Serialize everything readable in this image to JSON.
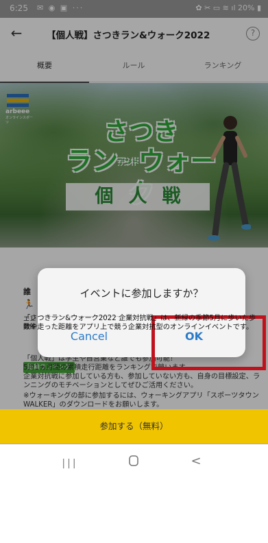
{
  "status_bar": {
    "time": "6:25",
    "left_icons": "✉ ◉ ▣ ···",
    "battery": "20%",
    "right_icons": "✿ ✂ ▭ ≋ ıl 20% ▮"
  },
  "header": {
    "back_icon": "←",
    "title": "【個人戦】さつきラン&ウォーク2022",
    "help_icon": "?"
  },
  "tabs": [
    {
      "label": "概要",
      "active": true
    },
    {
      "label": "ルール",
      "active": false
    },
    {
      "label": "ランキング",
      "active": false
    }
  ],
  "hero": {
    "logo_brand": "arbeee",
    "logo_sub": "オンラインスポーツ",
    "title_line1": "さつき",
    "title_line2a": "ラン",
    "title_and": "アンド",
    "title_line2b": "ウォーク",
    "subtitle": "個人戦"
  },
  "content": {
    "category_prefix": "誰",
    "runner_icon": "🏃",
    "small_text": "エン\n開催",
    "ranking_badge": "距離ランキング",
    "paragraph1": "「さつきラン&ウォーク2022 企業対抗戦」は、新緑の季節5月に歩いた歩数や走った距離をアプリ上で競う企業対抗型のオンラインイベントです。",
    "paragraph2": "「個人戦」は学生や自営業など誰でも参加可能！\n5月1ヵ月間の累積走行距離をランキングで競います。\n企業対抗戦に参加している方も、参加していない方も、自身の目標設定、ランニングのモチベーションとしてぜひご活用ください。",
    "paragraph3": "※ウォーキングの部に参加するには、ウォーキングアプリ「スポーツタウンWALKER」のダウンロードをお願いします。"
  },
  "dialog": {
    "message": "イベントに参加しますか？",
    "cancel_label": "Cancel",
    "ok_label": "OK"
  },
  "join_button": {
    "label": "参加する（無料）"
  },
  "nav_bar": {
    "recents_icon": "|||",
    "home_icon": "▢",
    "back_icon": "<"
  },
  "colors": {
    "accent_yellow": "#f1c400",
    "dialog_button_blue": "#2a7ac8",
    "highlight_red": "#c0121c",
    "title_green": "#2fae3a"
  }
}
